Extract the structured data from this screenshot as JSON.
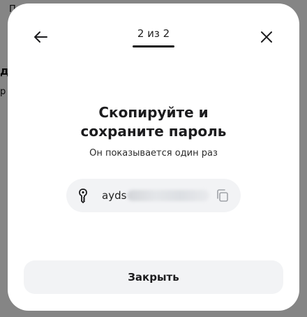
{
  "background": {
    "fragments": [
      "П",
      "д",
      "р"
    ]
  },
  "modal": {
    "back_icon": "arrow-left-icon",
    "close_icon": "close-icon",
    "stepper": {
      "text": "2 из 2",
      "current": 2,
      "total": 2
    },
    "title_line1": "Скопируйте и",
    "title_line2": "сохраните пароль",
    "subtitle": "Он показывается один раз",
    "password": {
      "key_icon": "key-icon",
      "visible_prefix": "ayds",
      "copy_icon": "copy-icon"
    },
    "close_button_label": "Закрыть"
  },
  "colors": {
    "overlay": "#6e6e6e",
    "modal_bg": "#ffffff",
    "field_bg": "#f2f3f5",
    "text": "#1c1c1e"
  }
}
